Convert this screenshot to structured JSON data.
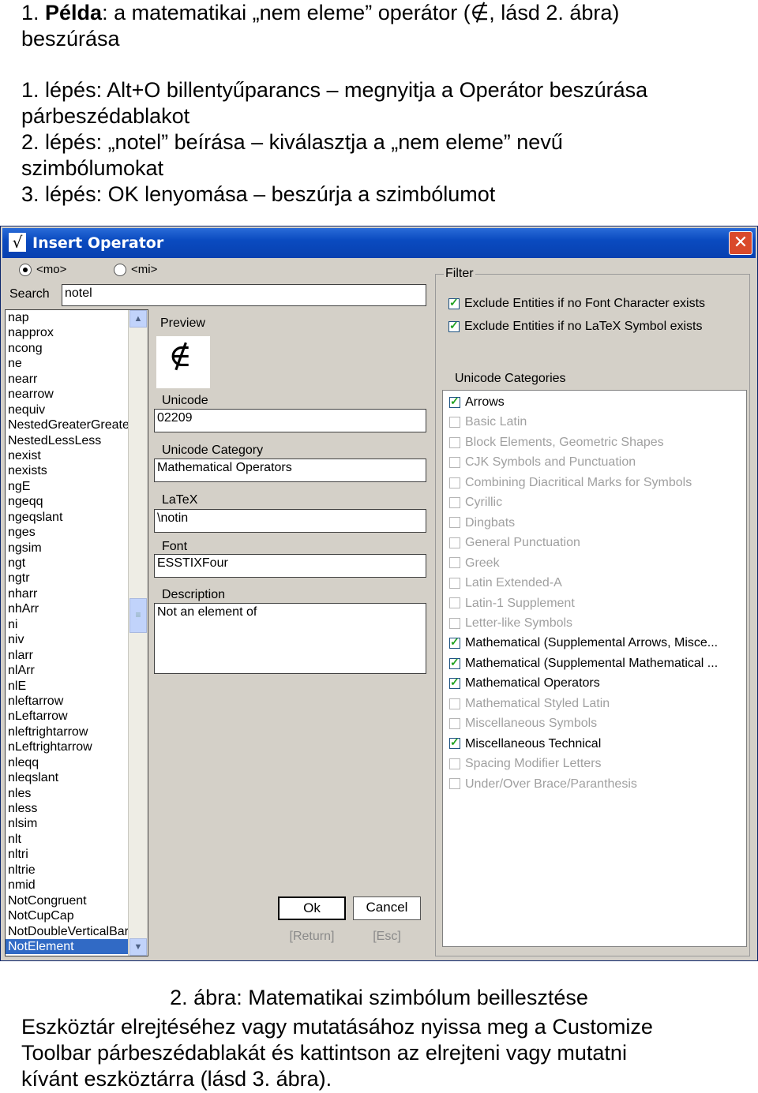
{
  "doc": {
    "heading_num": "1. ",
    "heading_bold": "Példa",
    "heading_rest_a": ": a matematikai „nem eleme” operátor (",
    "heading_symbol": "∉",
    "heading_rest_b": ", lásd 2. ábra)",
    "heading_line2": "beszúrása",
    "step1_a": "1. lépés: Alt+O billentyűparancs – megnyitja a Operátor beszúrása",
    "step1_b": "párbeszédablakot",
    "step2_a": "2. lépés: „notel” beírása – kiválasztja a „nem eleme” nevű",
    "step2_b": "szimbólumokat",
    "step3": "3. lépés: OK lenyomása – beszúrja a szimbólumot",
    "caption": "2. ábra: Matematikai szimbólum beillesztése",
    "bottom_a": "Eszköztár elrejtéséhez vagy mutatásához nyissa meg a Customize",
    "bottom_b": "Toolbar párbeszédablakát és kattintson az elrejteni vagy mutatni",
    "bottom_c": "kívánt eszköztárra (lásd 3. ábra)."
  },
  "dialog": {
    "title_icon": "√",
    "title": "Insert Operator",
    "close": "✕",
    "radio_mo": "<mo>",
    "radio_mi": "<mi>",
    "search_label": "Search",
    "search_value": "notel",
    "list_items": [
      "nap",
      "napprox",
      "ncong",
      "ne",
      "nearr",
      "nearrow",
      "nequiv",
      "NestedGreaterGreater",
      "NestedLessLess",
      "nexist",
      "nexists",
      "ngE",
      "ngeqq",
      "ngeqslant",
      "nges",
      "ngsim",
      "ngt",
      "ngtr",
      "nharr",
      "nhArr",
      "ni",
      "niv",
      "nlarr",
      "nlArr",
      "nlE",
      "nleftarrow",
      "nLeftarrow",
      "nleftrightarrow",
      "nLeftrightarrow",
      "nleqq",
      "nleqslant",
      "nles",
      "nless",
      "nlsim",
      "nlt",
      "nltri",
      "nltrie",
      "nmid",
      "NotCongruent",
      "NotCupCap",
      "NotDoubleVerticalBar",
      "NotElement"
    ],
    "selected_item": "NotElement",
    "preview_label": "Preview",
    "preview_glyph": "∉",
    "unicode_label": "Unicode",
    "unicode_value": "02209",
    "category_label": "Unicode Category",
    "category_value": "Mathematical Operators",
    "latex_label": "LaTeX",
    "latex_value": "\\notin",
    "font_label": "Font",
    "font_value": "ESSTIXFour",
    "description_label": "Description",
    "description_value": "Not an element of",
    "ok_label": "Ok",
    "cancel_label": "Cancel",
    "ok_hint": "[Return]",
    "cancel_hint": "[Esc]",
    "filter_label": "Filter",
    "exclude_font": "Exclude Entities if no Font Character exists",
    "exclude_latex": "Exclude Entities if no LaTeX Symbol exists",
    "categories_label": "Unicode Categories",
    "categories": [
      {
        "name": "Arrows",
        "checked": true
      },
      {
        "name": "Basic Latin",
        "checked": false
      },
      {
        "name": "Block Elements, Geometric Shapes",
        "checked": false
      },
      {
        "name": "CJK Symbols and Punctuation",
        "checked": false
      },
      {
        "name": "Combining Diacritical Marks for Symbols",
        "checked": false
      },
      {
        "name": "Cyrillic",
        "checked": false
      },
      {
        "name": "Dingbats",
        "checked": false
      },
      {
        "name": "General Punctuation",
        "checked": false
      },
      {
        "name": "Greek",
        "checked": false
      },
      {
        "name": "Latin Extended-A",
        "checked": false
      },
      {
        "name": "Latin-1 Supplement",
        "checked": false
      },
      {
        "name": "Letter-like Symbols",
        "checked": false
      },
      {
        "name": "Mathematical (Supplemental Arrows, Misce...",
        "checked": true
      },
      {
        "name": "Mathematical (Supplemental Mathematical ...",
        "checked": true
      },
      {
        "name": "Mathematical Operators",
        "checked": true
      },
      {
        "name": "Mathematical Styled Latin",
        "checked": false
      },
      {
        "name": "Miscellaneous Symbols",
        "checked": false
      },
      {
        "name": "Miscellaneous Technical",
        "checked": true
      },
      {
        "name": "Spacing Modifier Letters",
        "checked": false
      },
      {
        "name": "Under/Over Brace/Paranthesis",
        "checked": false
      }
    ]
  }
}
